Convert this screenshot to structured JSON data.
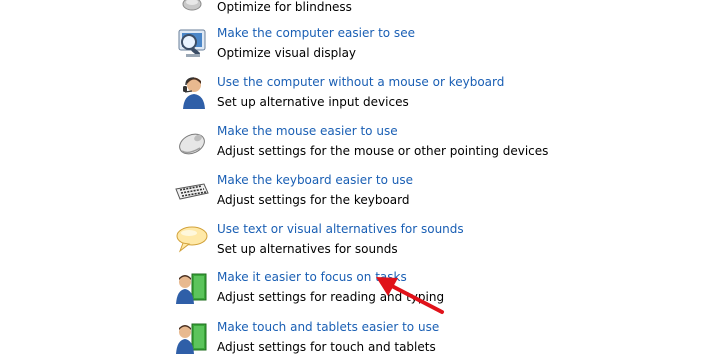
{
  "items": [
    {
      "title": "",
      "description": "Optimize for blindness",
      "icon": "speaker-icon"
    },
    {
      "title": "Make the computer easier to see",
      "description": "Optimize visual display",
      "icon": "monitor-magnifier-icon"
    },
    {
      "title": "Use the computer without a mouse or keyboard",
      "description": "Set up alternative input devices",
      "icon": "person-headset-icon"
    },
    {
      "title": "Make the mouse easier to use",
      "description": "Adjust settings for the mouse or other pointing devices",
      "icon": "mouse-icon"
    },
    {
      "title": "Make the keyboard easier to use",
      "description": "Adjust settings for the keyboard",
      "icon": "keyboard-icon"
    },
    {
      "title": "Use text or visual alternatives for sounds",
      "description": "Set up alternatives for sounds",
      "icon": "speech-bubble-icon"
    },
    {
      "title": "Make it easier to focus on tasks",
      "description": "Adjust settings for reading and typing",
      "icon": "person-document-icon"
    },
    {
      "title": "Make touch and tablets easier to use",
      "description": "Adjust settings for touch and tablets",
      "icon": "person-tablet-icon"
    }
  ],
  "colors": {
    "link": "#1a5fb4",
    "text": "#000000",
    "annotation_arrow": "#e0121a"
  }
}
